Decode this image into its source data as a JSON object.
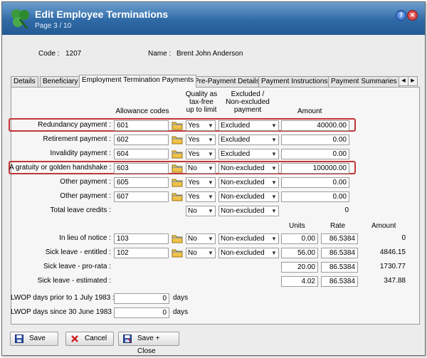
{
  "window": {
    "title": "Edit Employee Terminations",
    "subtitle": "Page 3 / 10",
    "help_icon": "help-icon",
    "close_icon": "close-icon"
  },
  "employee": {
    "code_label": "Code :",
    "code_value": "1207",
    "name_label": "Name :",
    "name_value": "Brent John Anderson"
  },
  "tabs": [
    {
      "label": "Details"
    },
    {
      "label": "Beneficiary"
    },
    {
      "label": "Employment Termination Payments"
    },
    {
      "label": "Pre-Payment Details"
    },
    {
      "label": "Payment Instructions"
    },
    {
      "label": "Payment Summaries"
    }
  ],
  "headers": {
    "allowance_codes": "Allowance codes",
    "quality": "Quality as tax-free up to limit",
    "quality_lines": [
      "Quality as",
      "tax-free",
      "up to limit"
    ],
    "excluded_lines": [
      "Excluded /",
      "Non-excluded",
      "payment"
    ],
    "amount": "Amount",
    "units": "Units",
    "rate": "Rate",
    "amount2": "Amount"
  },
  "payments": [
    {
      "label": "Redundancy payment :",
      "code": "601",
      "quality": "Yes",
      "excluded": "Excluded",
      "amount": "40000.00"
    },
    {
      "label": "Retirement payment :",
      "code": "602",
      "quality": "Yes",
      "excluded": "Excluded",
      "amount": "0.00"
    },
    {
      "label": "Invalidity payment :",
      "code": "604",
      "quality": "Yes",
      "excluded": "Excluded",
      "amount": "0.00"
    },
    {
      "label": "A gratuity or golden handshake :",
      "code": "603",
      "quality": "No",
      "excluded": "Non-excluded",
      "amount": "100000.00"
    },
    {
      "label": "Other payment :",
      "code": "605",
      "quality": "Yes",
      "excluded": "Non-excluded",
      "amount": "0.00"
    },
    {
      "label": "Other payment :",
      "code": "607",
      "quality": "Yes",
      "excluded": "Non-excluded",
      "amount": "0.00"
    }
  ],
  "total_leave": {
    "label": "Total leave credits :",
    "quality": "No",
    "excluded": "Non-excluded",
    "amount": "0"
  },
  "leave_rows": [
    {
      "label": "In lieu of notice :",
      "code": "103",
      "quality": "No",
      "excluded": "Non-excluded",
      "units": "0.00",
      "rate": "86.5384",
      "amount": "0"
    },
    {
      "label": "Sick leave - entitled :",
      "code": "102",
      "quality": "No",
      "excluded": "Non-excluded",
      "units": "56.00",
      "rate": "86.5384",
      "amount": "4846.15"
    },
    {
      "label": "Sick leave - pro-rata :",
      "units": "20.00",
      "rate": "86.5384",
      "amount": "1730.77"
    },
    {
      "label": "Sick leave - estimated :",
      "units": "4.02",
      "rate": "86.5384",
      "amount": "347.88"
    }
  ],
  "lwop": [
    {
      "label": "LWOP days prior to 1 July 1983 :",
      "value": "0",
      "unit": "days"
    },
    {
      "label": "LWOP days since 30 June 1983 :",
      "value": "0",
      "unit": "days"
    }
  ],
  "buttons": {
    "save": "Save",
    "cancel": "Cancel",
    "save_close": "Save + Close"
  },
  "colors": {
    "title_bar": "#2f6aa6",
    "highlight": "#c33636",
    "panel": "#f6f6f6"
  }
}
